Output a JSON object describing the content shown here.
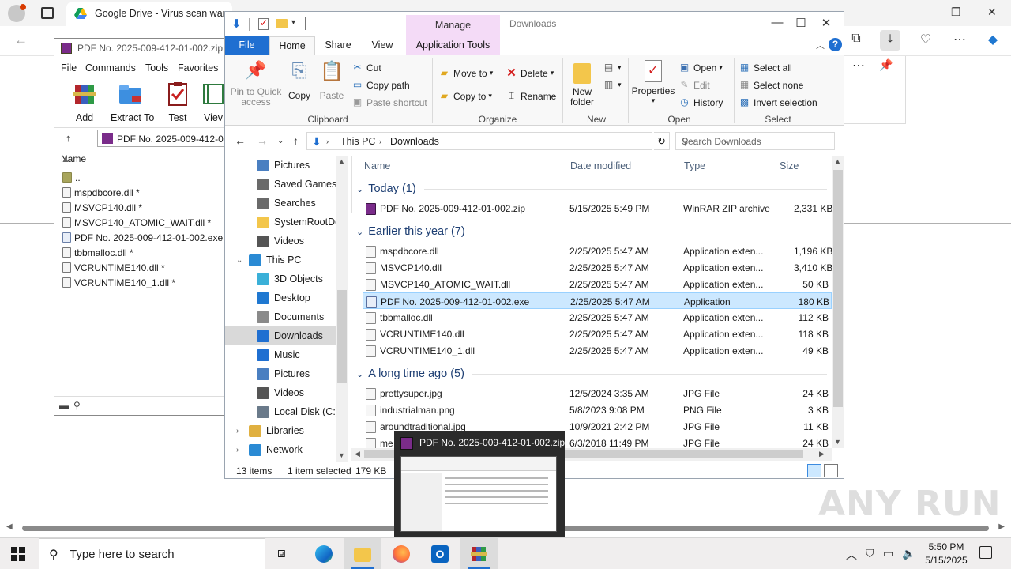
{
  "browser": {
    "tab_title": "Google Drive - Virus scan warni",
    "panel": {
      "more_label": "⋯",
      "pin_label": "📌"
    }
  },
  "winrar": {
    "title": "PDF No. 2025-009-412-01-002.zip",
    "menu": [
      "File",
      "Commands",
      "Tools",
      "Favorites"
    ],
    "toolbar": [
      {
        "label": "Add",
        "icon": "winrar-books-icon"
      },
      {
        "label": "Extract To",
        "icon": "extract-folder-icon"
      },
      {
        "label": "Test",
        "icon": "test-clipboard-icon"
      },
      {
        "label": "Viev",
        "icon": "view-book-icon"
      }
    ],
    "path": "PDF No. 2025-009-412-01-",
    "column_name": "Name",
    "files": [
      {
        "name": "..",
        "type": "folder"
      },
      {
        "name": "mspdbcore.dll *",
        "type": "dll"
      },
      {
        "name": "MSVCP140.dll *",
        "type": "dll"
      },
      {
        "name": "MSVCP140_ATOMIC_WAIT.dll *",
        "type": "dll"
      },
      {
        "name": "PDF No. 2025-009-412-01-002.exe *",
        "type": "exe"
      },
      {
        "name": "tbbmalloc.dll *",
        "type": "dll"
      },
      {
        "name": "VCRUNTIME140.dll *",
        "type": "dll"
      },
      {
        "name": "VCRUNTIME140_1.dll *",
        "type": "dll"
      }
    ]
  },
  "explorer": {
    "title": "Downloads",
    "manage_label": "Manage",
    "ribbon_tabs": {
      "file": "File",
      "home": "Home",
      "share": "Share",
      "view": "View",
      "app_tools": "Application Tools"
    },
    "clipboard": {
      "group": "Clipboard",
      "pin": "Pin to Quick access",
      "copy": "Copy",
      "paste": "Paste",
      "cut": "Cut",
      "copy_path": "Copy path",
      "paste_shortcut": "Paste shortcut"
    },
    "organize": {
      "group": "Organize",
      "move_to": "Move to",
      "copy_to": "Copy to",
      "delete": "Delete",
      "rename": "Rename"
    },
    "new": {
      "group": "New",
      "new_folder": "New folder"
    },
    "open": {
      "group": "Open",
      "properties": "Properties",
      "open": "Open",
      "edit": "Edit",
      "history": "History"
    },
    "select": {
      "group": "Select",
      "select_all": "Select all",
      "select_none": "Select none",
      "invert": "Invert selection"
    },
    "address": {
      "this_pc": "This PC",
      "downloads": "Downloads",
      "search_placeholder": "Search Downloads"
    },
    "nav": [
      {
        "label": "Pictures",
        "icon": "pictures-icon",
        "color": "#4a7fc1"
      },
      {
        "label": "Saved Games",
        "icon": "saved-games-icon",
        "color": "#6a6a6a"
      },
      {
        "label": "Searches",
        "icon": "searches-icon",
        "color": "#6a6a6a"
      },
      {
        "label": "SystemRootDo",
        "icon": "folder-icon",
        "color": "#f3c64b"
      },
      {
        "label": "Videos",
        "icon": "videos-icon",
        "color": "#555555"
      },
      {
        "label": "This PC",
        "icon": "this-pc-icon",
        "color": "#2a8ad4"
      },
      {
        "label": "3D Objects",
        "icon": "3d-objects-icon",
        "color": "#3ab0d8"
      },
      {
        "label": "Desktop",
        "icon": "desktop-icon",
        "color": "#1f78d1"
      },
      {
        "label": "Documents",
        "icon": "documents-icon",
        "color": "#8a8a8a"
      },
      {
        "label": "Downloads",
        "icon": "downloads-icon",
        "color": "#1f6fd1"
      },
      {
        "label": "Music",
        "icon": "music-icon",
        "color": "#1f6fd1"
      },
      {
        "label": "Pictures",
        "icon": "pictures-icon",
        "color": "#4a7fc1"
      },
      {
        "label": "Videos",
        "icon": "videos-icon",
        "color": "#555555"
      },
      {
        "label": "Local Disk (C:)",
        "icon": "local-disk-icon",
        "color": "#6a7a8a"
      },
      {
        "label": "Libraries",
        "icon": "libraries-icon",
        "color": "#e0b040"
      },
      {
        "label": "Network",
        "icon": "network-icon",
        "color": "#2a8ad4"
      }
    ],
    "columns": {
      "name": "Name",
      "date": "Date modified",
      "type": "Type",
      "size": "Size"
    },
    "groups": {
      "today": "Today (1)",
      "earlier": "Earlier this year (7)",
      "long_ago": "A long time ago (5)"
    },
    "files_today": [
      {
        "name": "PDF No. 2025-009-412-01-002.zip",
        "date": "5/15/2025 5:49 PM",
        "type": "WinRAR ZIP archive",
        "size": "2,331 KB",
        "kind": "zip"
      }
    ],
    "files_earlier": [
      {
        "name": "mspdbcore.dll",
        "date": "2/25/2025 5:47 AM",
        "type": "Application exten...",
        "size": "1,196 KB",
        "kind": "dll"
      },
      {
        "name": "MSVCP140.dll",
        "date": "2/25/2025 5:47 AM",
        "type": "Application exten...",
        "size": "3,410 KB",
        "kind": "dll"
      },
      {
        "name": "MSVCP140_ATOMIC_WAIT.dll",
        "date": "2/25/2025 5:47 AM",
        "type": "Application exten...",
        "size": "50 KB",
        "kind": "dll"
      },
      {
        "name": "PDF No. 2025-009-412-01-002.exe",
        "date": "2/25/2025 5:47 AM",
        "type": "Application",
        "size": "180 KB",
        "kind": "exe"
      },
      {
        "name": "tbbmalloc.dll",
        "date": "2/25/2025 5:47 AM",
        "type": "Application exten...",
        "size": "112 KB",
        "kind": "dll"
      },
      {
        "name": "VCRUNTIME140.dll",
        "date": "2/25/2025 5:47 AM",
        "type": "Application exten...",
        "size": "118 KB",
        "kind": "dll"
      },
      {
        "name": "VCRUNTIME140_1.dll",
        "date": "2/25/2025 5:47 AM",
        "type": "Application exten...",
        "size": "49 KB",
        "kind": "dll"
      }
    ],
    "files_long_ago": [
      {
        "name": "prettysuper.jpg",
        "date": "12/5/2024 3:35 AM",
        "type": "JPG File",
        "size": "24 KB",
        "kind": "img"
      },
      {
        "name": "industrialman.png",
        "date": "5/8/2023 9:08 PM",
        "type": "PNG File",
        "size": "3 KB",
        "kind": "img"
      },
      {
        "name": "aroundtraditional.jpg",
        "date": "10/9/2021 2:42 PM",
        "type": "JPG File",
        "size": "11 KB",
        "kind": "img"
      },
      {
        "name": "me",
        "date": "6/3/2018 11:49 PM",
        "type": "JPG File",
        "size": "24 KB",
        "kind": "img"
      }
    ],
    "status": {
      "count": "13 items",
      "selected": "1 item selected",
      "size": "179 KB"
    }
  },
  "thumbnail": {
    "title": "PDF No. 2025-009-412-01-002.zip"
  },
  "watermark": "ANY RUN",
  "taskbar": {
    "search_placeholder": "Type here to search",
    "time": "5:50 PM",
    "date": "5/15/2025",
    "apps": [
      {
        "name": "task-view",
        "color": "#333333"
      },
      {
        "name": "edge",
        "color": "#1f9ad8"
      },
      {
        "name": "file-explorer",
        "color": "#f3c64b"
      },
      {
        "name": "firefox",
        "color": "#ff7139"
      },
      {
        "name": "outlook",
        "color": "#0a64c0"
      },
      {
        "name": "winrar",
        "color": "#7a2c8a"
      }
    ]
  }
}
